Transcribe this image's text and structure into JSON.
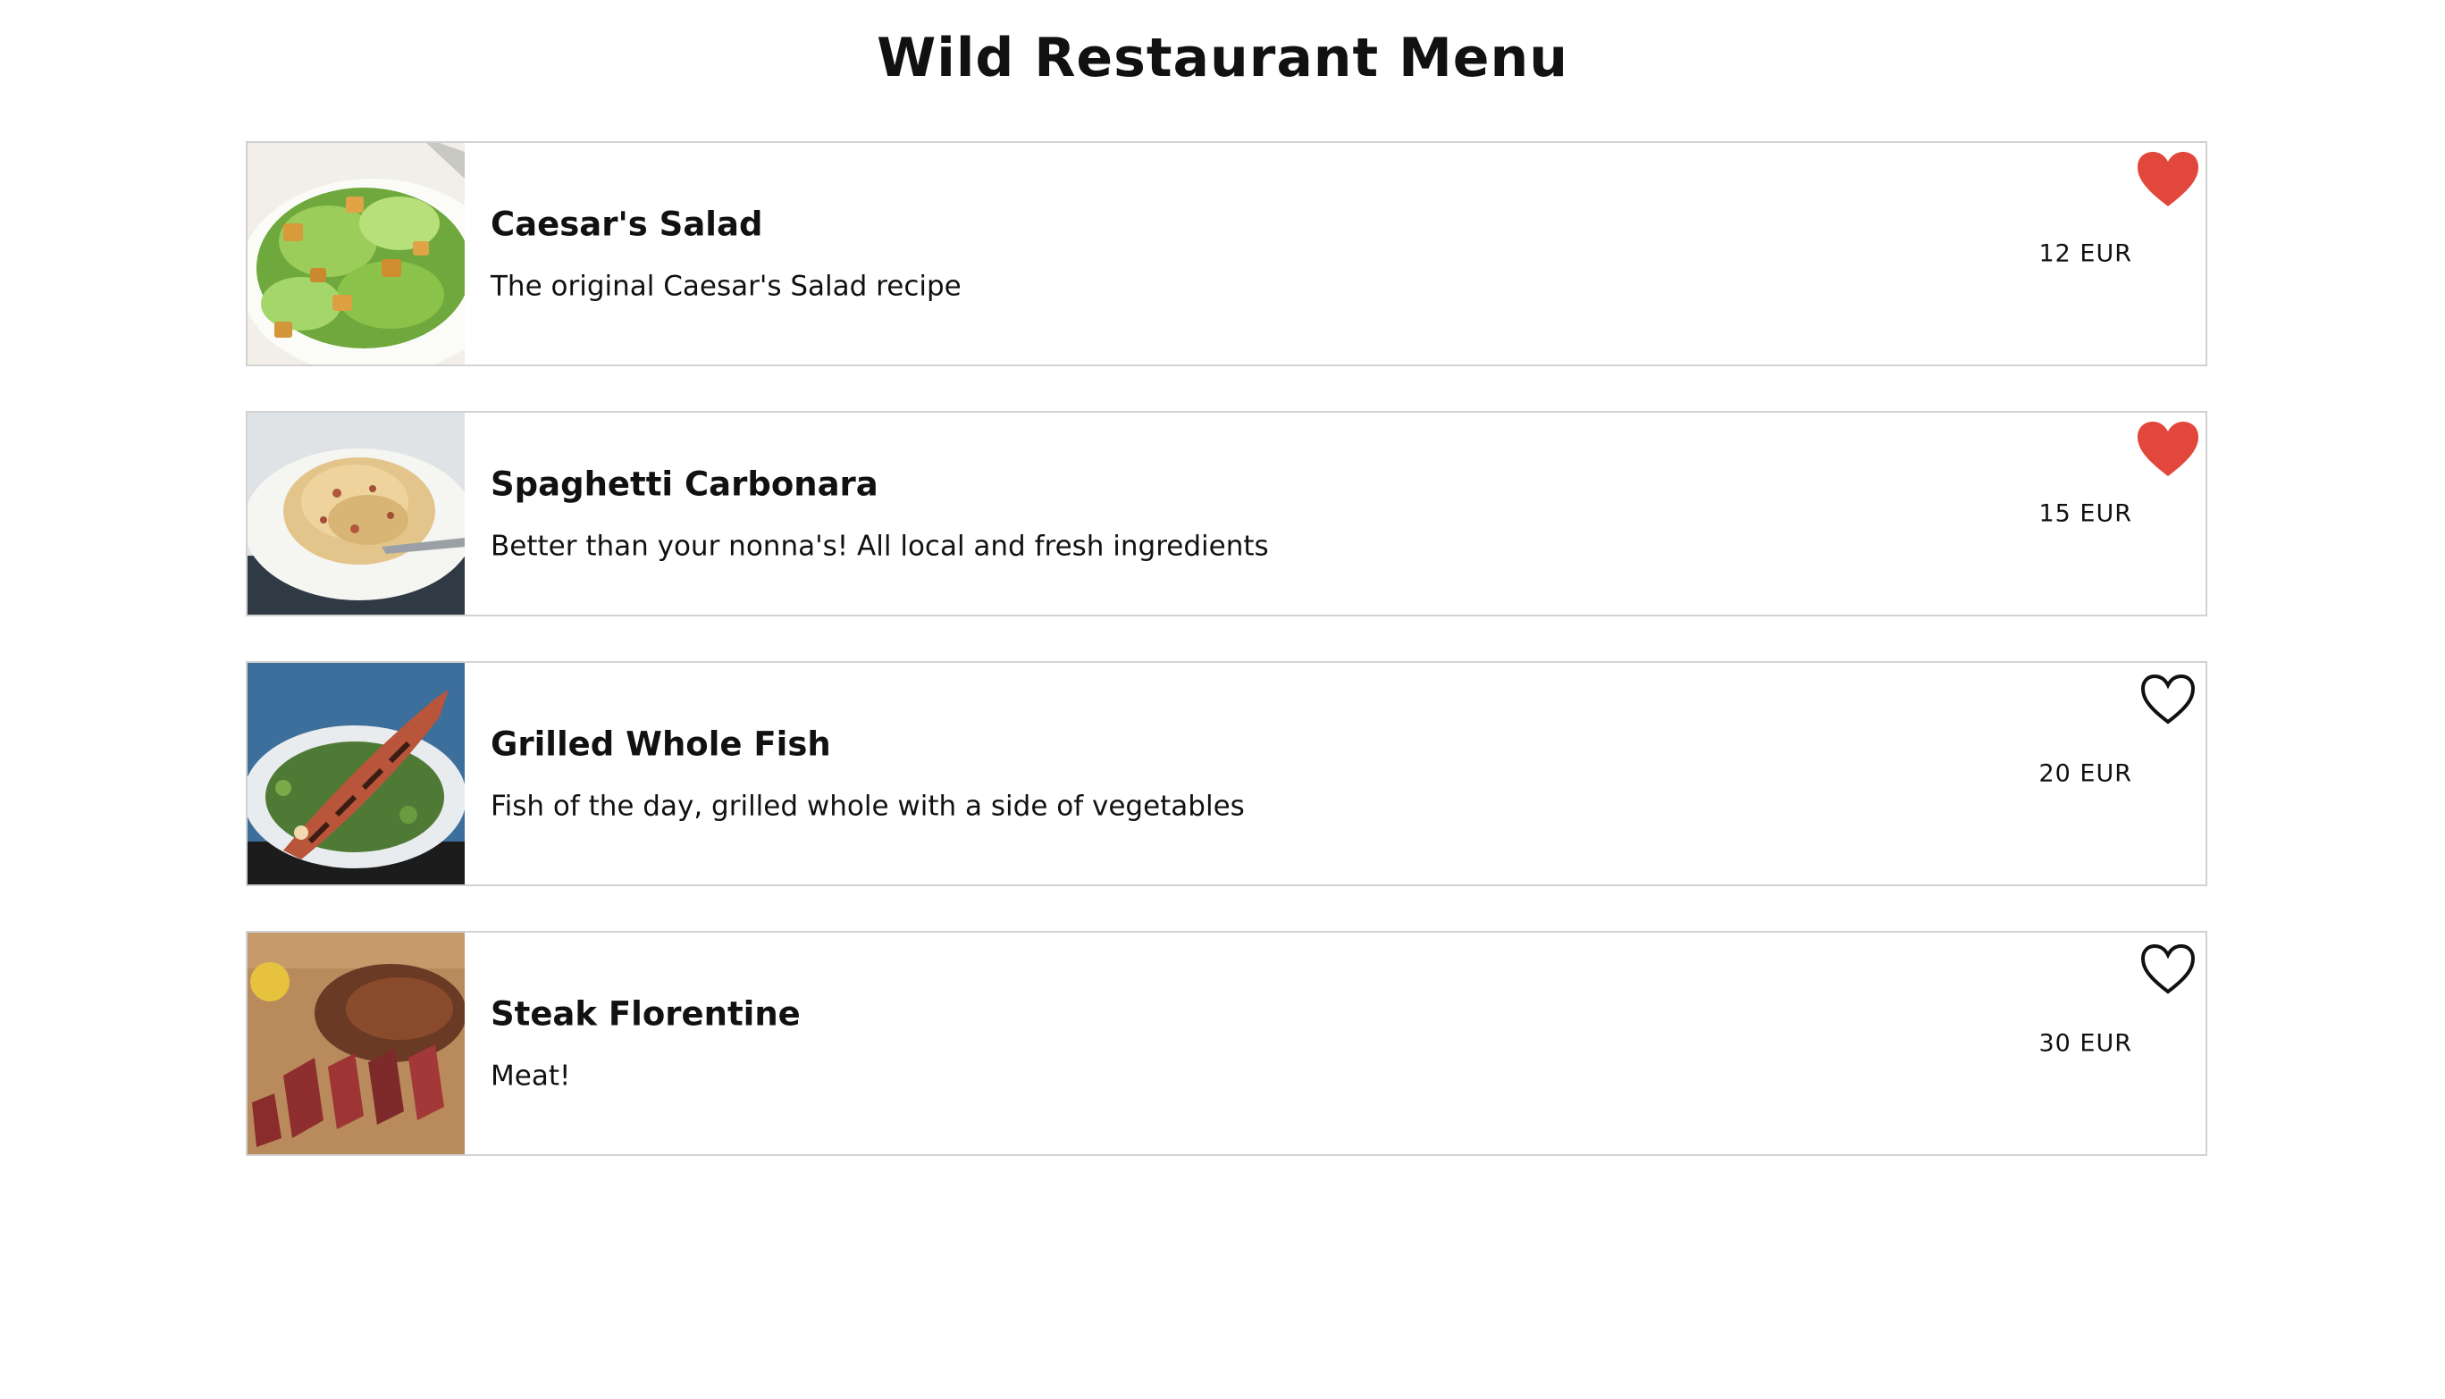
{
  "page": {
    "title": "Wild Restaurant Menu"
  },
  "colors": {
    "favorite_on": "#e2473b",
    "favorite_off_stroke": "#111111",
    "card_border": "#d2d2d2"
  },
  "menu": {
    "items": [
      {
        "name": "Caesar's Salad",
        "description": "The original Caesar's Salad recipe",
        "price": "12 EUR",
        "favorite": true,
        "icon": "heart-filled-icon"
      },
      {
        "name": "Spaghetti Carbonara",
        "description": "Better than your nonna's! All local and fresh ingredients",
        "price": "15 EUR",
        "favorite": true,
        "icon": "heart-filled-icon"
      },
      {
        "name": "Grilled Whole Fish",
        "description": "Fish of the day, grilled whole with a side of vegetables",
        "price": "20 EUR",
        "favorite": false,
        "icon": "heart-outline-icon"
      },
      {
        "name": "Steak Florentine",
        "description": "Meat!",
        "price": "30 EUR",
        "favorite": false,
        "icon": "heart-outline-icon"
      }
    ]
  }
}
